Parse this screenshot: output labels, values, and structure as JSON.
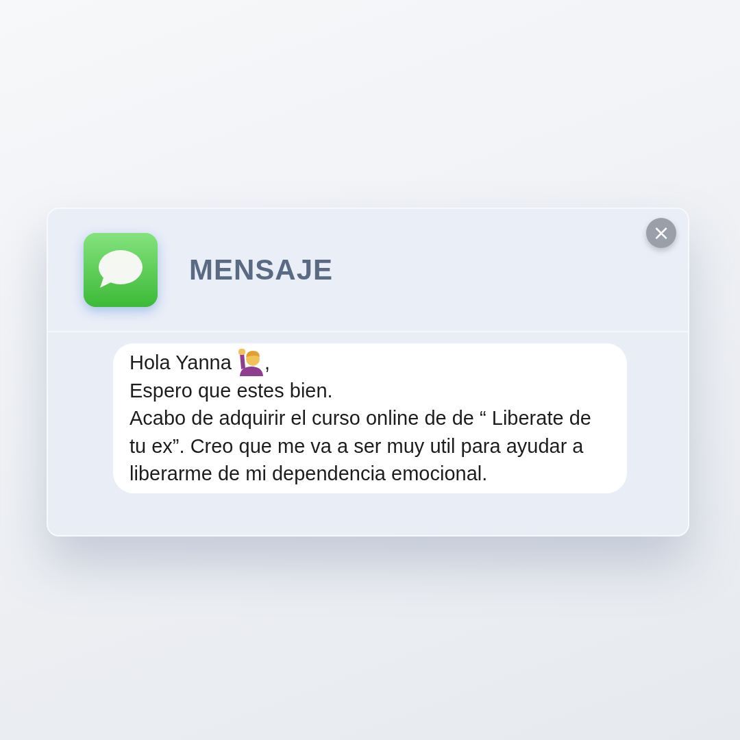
{
  "notification": {
    "title": "MENSAJE",
    "close": "×",
    "message": {
      "greeting": "Hola Yanna",
      "greeting_end": ",",
      "lines": [
        "Espero que estes bien.",
        "Acabo de adquirir el curso online de de “ Liberate de tu ex”. Creo que me va a ser muy util para ayudar a liberarme de mi dependencia emocional."
      ]
    }
  }
}
